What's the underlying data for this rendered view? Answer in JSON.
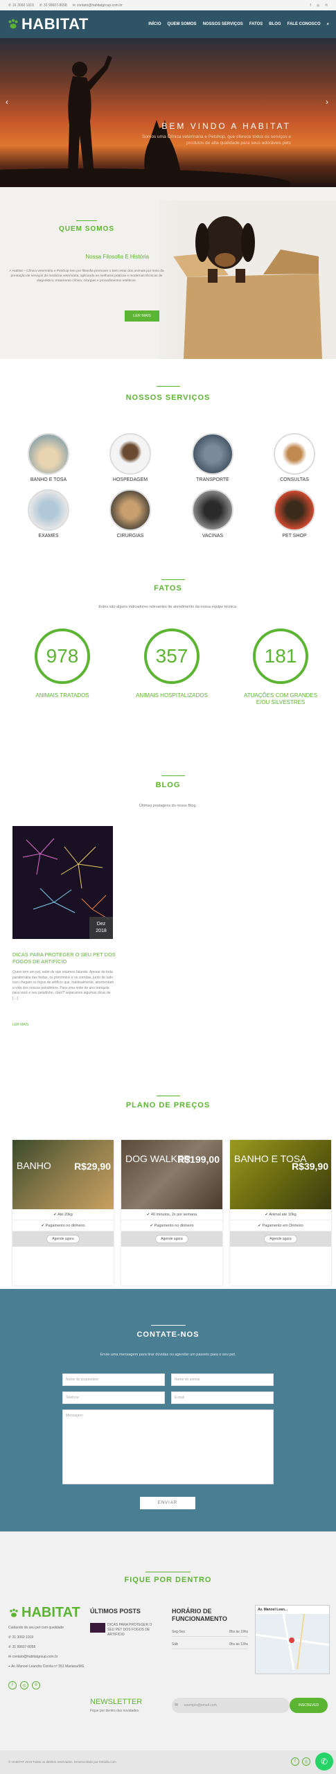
{
  "topbar": {
    "phone1": "31 3060 1919",
    "phone2": "31 99607-8058",
    "email": "contato@habitatgroup.com.br"
  },
  "header": {
    "logo": "HABITAT",
    "nav": [
      "INÍCIO",
      "QUEM SOMOS",
      "NOSSOS SERVIÇOS",
      "FATOS",
      "BLOG",
      "FALE CONOSCO"
    ]
  },
  "hero": {
    "title": "BEM VINDO A HABITAT",
    "subtitle": "Somos uma Clínica veterinária e Petshop, que oferece todos os serviços e produtos de alta qualidade para seus adoráveis pets"
  },
  "about": {
    "title": "QUEM SOMOS",
    "subtitle": "Nossa Filosofia E História",
    "text": "A Habitat – Clínica veterinária e Petshop tem por filosofia promover o bem estar dos animais por meio da prestação de serviços de medicina veterinária, aplicando as melhores práticas e modernas técnicas de diagnóstico, tratamento clínico, cirurgias e procedimentos estéticos.",
    "button": "LER MAIS"
  },
  "services": {
    "title": "NOSSOS SERVIÇOS",
    "items": [
      "BANHO E TOSA",
      "HOSPEDAGEM",
      "TRANSPORTE",
      "CONSULTAS",
      "EXAMES",
      "CIRURGIAS",
      "VACINAS",
      "PET SHOP"
    ]
  },
  "facts": {
    "title": "FATOS",
    "subtitle": "Estes são alguns indicadores relevantes de atendimento da nossa equipe técnica.",
    "items": [
      {
        "num": "978",
        "label": "ANIMAIS TRATADOS"
      },
      {
        "num": "357",
        "label": "ANIMAIS HOSPITALIZADOS"
      },
      {
        "num": "181",
        "label": "ATUAÇÕES COM GRANDES E/OU SILVESTRES"
      }
    ]
  },
  "blog": {
    "title": "BLOG",
    "subtitle": "Últimas postagens do nosso Blog.",
    "date_month": "Dez",
    "date_year": "2018",
    "post_title": "DICAS PARA PROTEGER O SEU PET DOS FOGOS DE ARTIFÍCIO",
    "excerpt": "Quem tem um pet, sabe do que estamos falando. Apesar de toda parafernália das festas, os prenômios e os corridas, junto de tudo isso chegam os fogos de artifício que, habitualmente, atormentam a vida dos nossos peludinhos. Para uma noite de ano tranquila para você e seu peludinho, claro? separamos algumas dicas de […]",
    "read_more": "LER MAIS"
  },
  "plans": {
    "title": "PLANO DE PREÇOS",
    "items": [
      {
        "name": "BANHO",
        "price": "R$29,90",
        "f1": "Até 20kg",
        "f2": "Pagamento no dinheiro",
        "btn": "Agende agora"
      },
      {
        "name": "DOG WALKER",
        "price": "R$199,00",
        "f1": "40 minutos, 2x por semana",
        "f2": "Pagamento no dinheiro",
        "btn": "Agende agora"
      },
      {
        "name": "BANHO E TOSA",
        "price": "R$39,90",
        "f1": "Animal até 10kg",
        "f2": "Pagamento em Dinheiro",
        "btn": "Agende agora"
      }
    ]
  },
  "contact": {
    "title": "CONTATE-NOS",
    "subtitle": "Envie uma mensagem para tirar dúvidas ou agendar um passeio para o seu pet.",
    "name_ph": "Nome do proprietário",
    "pet_ph": "Nome do animal",
    "phone_ph": "Telefone",
    "email_ph": "E-mail",
    "msg_ph": "Mensagem",
    "send": "ENVIAR"
  },
  "footer": {
    "follow": "FIQUE POR DENTRO",
    "logo": "HABITAT",
    "tagline": "Cuidando do seu pet com qualidade",
    "phone1": "31 3060 1919",
    "phone2": "31 99607-8058",
    "email": "contato@habitatgroup.com.br",
    "address": "Av. Manoel Leandro Corrêa nº 351 Mariana/MG",
    "latest_title": "ÚLTIMOS POSTS",
    "latest_post": "DICAS PARA PROTEGER O SEU PET DOS FOGOS DE ARTIFÍCIO",
    "hours_title": "HORÁRIO DE FUNCIONAMENTO",
    "hours": [
      {
        "day": "Seg-Sex",
        "time": "8hs às 19hs"
      },
      {
        "day": "Sáb",
        "time": "9hs às 13hs"
      }
    ],
    "map_label": "Av. Manoel Lean...",
    "newsletter": "NEWSLETTER",
    "newsletter_sub": "Fique por dentro das novidades",
    "email_ph": "exemplo@email.com",
    "subscribe": "INSCREVER",
    "copyright": "© HABITAT 2019 Todos os direitos reservados. Desenvolvido por Estúdio.com"
  },
  "colors": {
    "accent": "#5cb532",
    "header": "#2f5466",
    "contact": "#497e93"
  }
}
